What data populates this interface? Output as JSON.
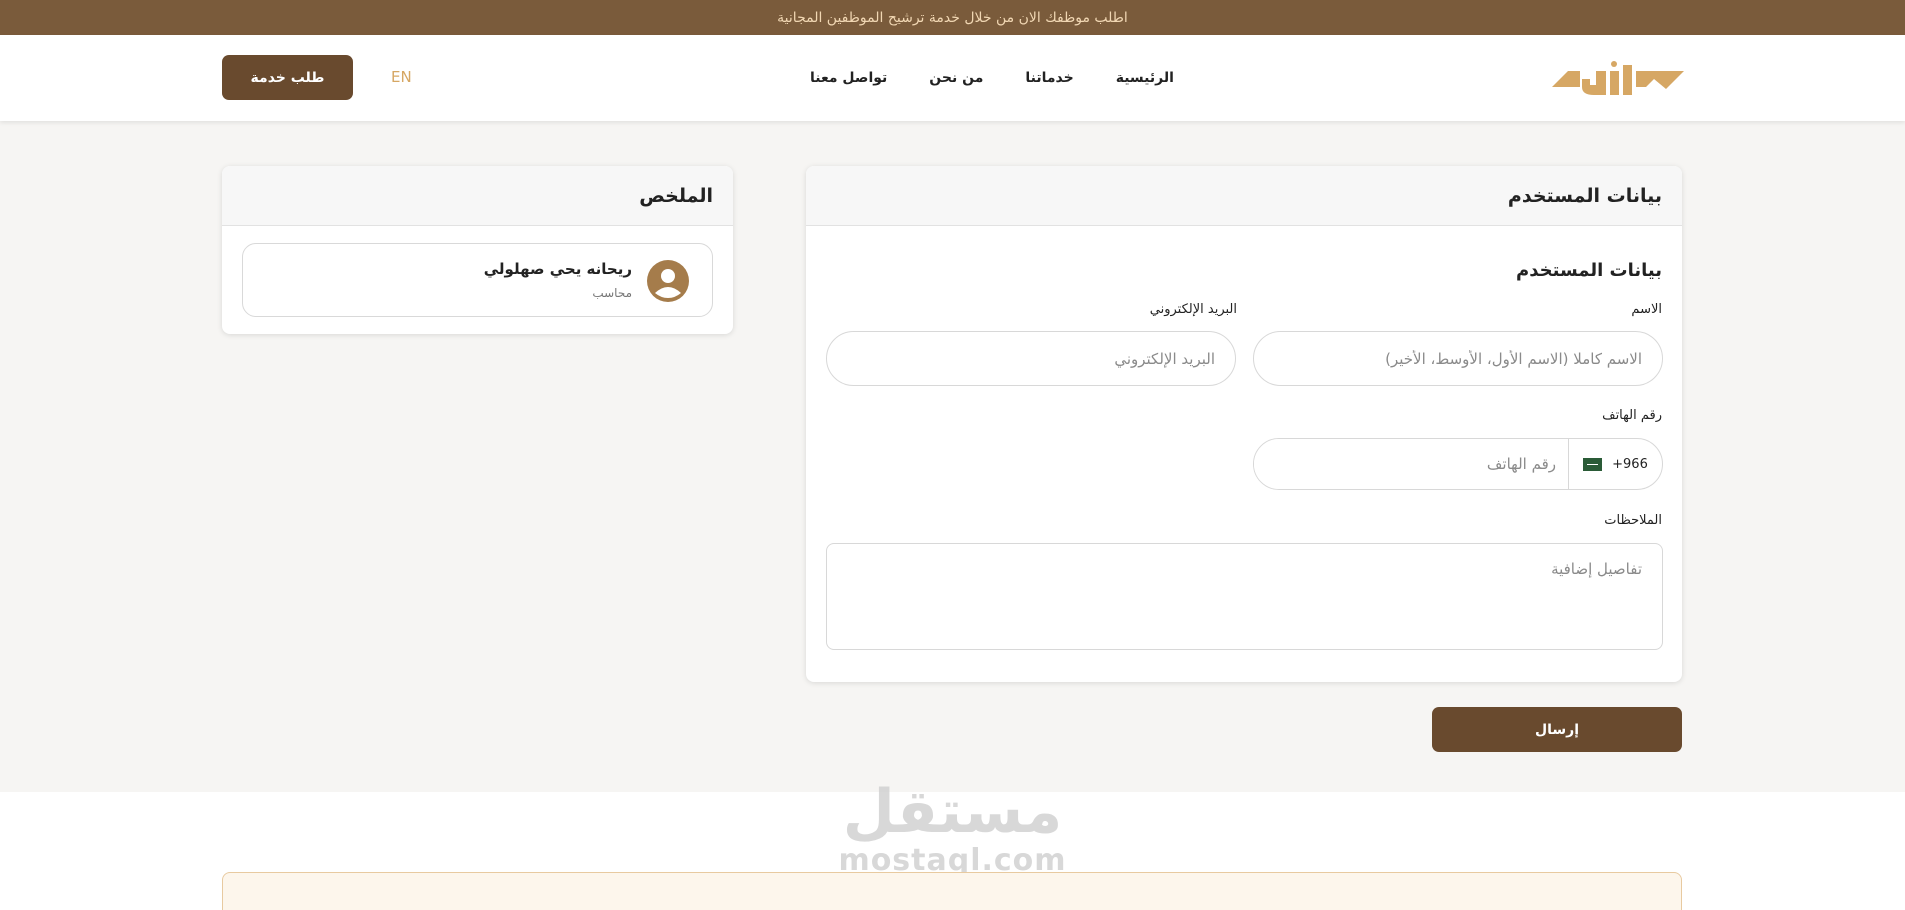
{
  "announcement": "اطلب موظفك الان من خلال خدمة ترشيح الموظفين المجانية",
  "header": {
    "logo_icon": "brand-logo-icon",
    "nav": [
      {
        "label": "الرئيسية"
      },
      {
        "label": "خدماتنا"
      },
      {
        "label": "من نحن"
      },
      {
        "label": "تواصل معنا"
      }
    ],
    "lang_toggle": "EN",
    "request_button": "طلب خدمة"
  },
  "summary": {
    "title": "الملخص",
    "user": {
      "name": "ريحانه يحي صهلولي",
      "role": "محاسب",
      "avatar_icon": "user-avatar-icon"
    }
  },
  "user_data": {
    "card_title": "بيانات المستخدم",
    "section_title": "بيانات المستخدم",
    "name": {
      "label": "الاسم",
      "placeholder": "الاسم كاملا (الاسم الأول، الأوسط، الأخير)",
      "value": ""
    },
    "email": {
      "label": "البريد الإلكتروني",
      "placeholder": "البريد الإلكتروني",
      "value": ""
    },
    "phone": {
      "label": "رقم الهاتف",
      "country_code": "+966",
      "flag_icon": "saudi-flag-icon",
      "placeholder": "رقم الهاتف",
      "value": ""
    },
    "notes": {
      "label": "الملاحظات",
      "placeholder": "تفاصيل إضافية",
      "value": ""
    }
  },
  "submit_button": "إرسال",
  "colors": {
    "brand_brown": "#694a2e",
    "announce_bg": "#7a5b3b",
    "accent_gold": "#d6a764",
    "page_bg": "#f6f5f3"
  }
}
